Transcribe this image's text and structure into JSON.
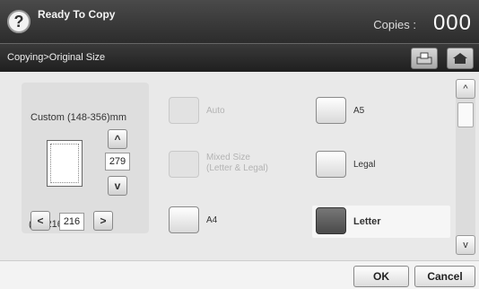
{
  "status": {
    "title": "Ready To Copy",
    "copies_label": "Copies :",
    "copies_value": "000",
    "help_label": "?"
  },
  "breadcrumb": "Copying>Original Size",
  "custom": {
    "label": "Custom (148-356)mm",
    "height_value": "279",
    "width_label": "(98-216)mm",
    "width_value": "216",
    "up": "^",
    "down": "v",
    "left": "<",
    "right": ">"
  },
  "options": {
    "auto": "Auto",
    "mixed_line1": "Mixed Size",
    "mixed_line2": "(Letter & Legal)",
    "a4": "A4",
    "a5": "A5",
    "legal": "Legal",
    "letter": "Letter"
  },
  "scroll": {
    "up": "^",
    "down": "v"
  },
  "actions": {
    "ok": "OK",
    "cancel": "Cancel"
  },
  "icons": {
    "help": "help-icon",
    "copy": "tray-icon",
    "home": "home-icon"
  }
}
